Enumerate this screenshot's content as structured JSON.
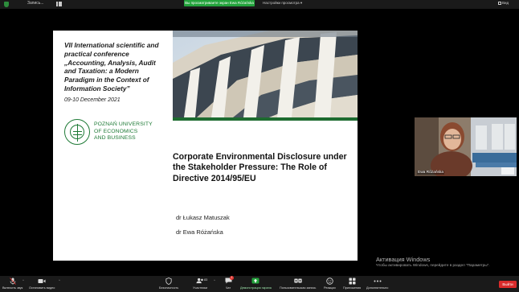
{
  "top_bar": {
    "recording_label": "Запись...",
    "share_banner": "Вы просматриваете экран Ewa Różańska",
    "view_options": "Настройки просмотра ▾",
    "view_button": "Вид"
  },
  "slide": {
    "conference": "VII International scientific and practical conference „Accounting, Analysis, Audit and Taxation: a Modern Paradigm in the Context of Information Society”",
    "dates": "09-10 December 2021",
    "university": [
      "POZNAŃ UNIVERSITY",
      "OF ECONOMICS",
      "AND BUSINESS"
    ],
    "title": "Corporate Environmental Disclosure under the Stakeholder Pressure: The Role of Directive 2014/95/EU",
    "authors": [
      "dr Łukasz Matuszak",
      "dr Ewa Różańska"
    ]
  },
  "participant": {
    "name": "Ewa Różańska"
  },
  "activation": {
    "title": "Активация Windows",
    "message": "Чтобы активировать Windows, перейдите в раздел \"Параметры\"."
  },
  "toolbar": {
    "items": [
      {
        "label": "Включить звук",
        "icon": "mic-muted-icon"
      },
      {
        "label": "Остановить видео",
        "icon": "video-camera-icon"
      },
      {
        "label": "Безопасность",
        "icon": "shield-icon"
      },
      {
        "label": "Участники",
        "icon": "participants-icon",
        "count": "83"
      },
      {
        "label": "Чат",
        "icon": "chat-icon",
        "badge": "1"
      },
      {
        "label": "Демонстрация экрана",
        "icon": "share-screen-icon"
      },
      {
        "label": "Пользовательская запись",
        "icon": "record-icon"
      },
      {
        "label": "Реакции",
        "icon": "reactions-icon"
      },
      {
        "label": "Приложения",
        "icon": "apps-icon"
      },
      {
        "label": "Дополнительно",
        "icon": "more-icon"
      }
    ],
    "end_button": "Выйти"
  },
  "colors": {
    "share_green": "#23a33c",
    "university_green": "#1e7a36",
    "end_red": "#d92b2b"
  }
}
